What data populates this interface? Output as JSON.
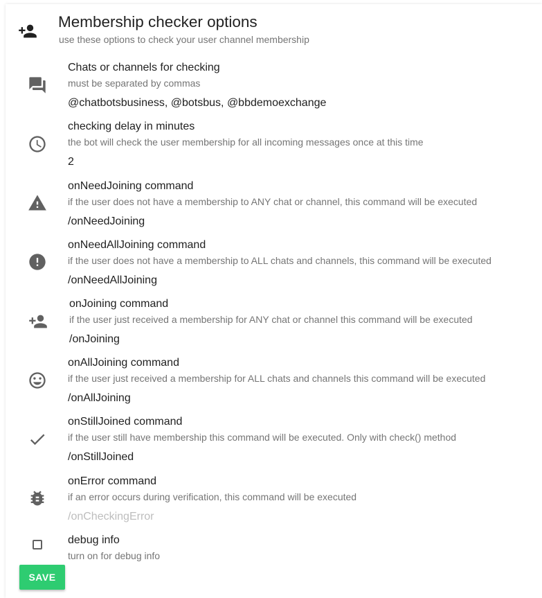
{
  "header": {
    "title": "Membership checker options",
    "subtitle": "use these options to check your user channel membership",
    "icon": "person-add-icon"
  },
  "fields": [
    {
      "label": "Chats or channels for checking",
      "hint": "must be separated by commas",
      "value": "@chatbotsbusiness, @botsbus, @bbdemoexchange",
      "placeholder": "",
      "icon": "chat-icon"
    },
    {
      "label": "checking delay in minutes",
      "hint": "the bot will check the user membership for all incoming messages once at this time",
      "value": "2",
      "placeholder": "",
      "icon": "clock-icon"
    },
    {
      "label": "onNeedJoining command",
      "hint": "if the user does not have a membership to ANY chat or channel, this command will be executed",
      "value": "/onNeedJoining",
      "placeholder": "",
      "icon": "warning-icon"
    },
    {
      "label": "onNeedAllJoining command",
      "hint": "if the user does not have a membership to ALL chats and channels, this command will be executed",
      "value": "/onNeedAllJoining",
      "placeholder": "",
      "icon": "error-icon"
    },
    {
      "label": "onJoining command",
      "hint": "if the user just received a membership for ANY chat or channel this command will be executed",
      "value": "/onJoining",
      "placeholder": "",
      "icon": "person-add-icon"
    },
    {
      "label": "onAllJoining command",
      "hint": "if the user just received a membership for ALL chats and channels this command will be executed",
      "value": "/onAllJoining",
      "placeholder": "",
      "icon": "smiley-icon"
    },
    {
      "label": "onStillJoined command",
      "hint": "if the user still have membership this command will be executed. Only with check() method",
      "value": "/onStillJoined",
      "placeholder": "",
      "icon": "check-icon"
    },
    {
      "label": "onError command",
      "hint": "if an error occurs during verification, this command will be executed",
      "value": "",
      "placeholder": "/onCheckingError",
      "icon": "bug-icon"
    }
  ],
  "debug": {
    "label": "debug info",
    "hint": "turn on for debug info",
    "checked": false
  },
  "save_label": "SAVE",
  "colors": {
    "icon": "#616161",
    "save": "#2ecc71"
  }
}
